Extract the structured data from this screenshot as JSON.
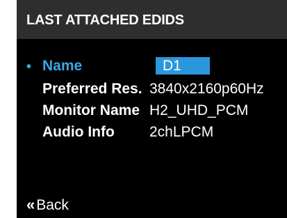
{
  "header": {
    "title": "LAST ATTACHED EDIDS"
  },
  "colors": {
    "selected_text": "#3ca7e0",
    "selected_box": "#2b97dd",
    "header_bg": "#2e2e2e",
    "screen_bg": "#000000"
  },
  "rows": [
    {
      "label": "Name",
      "value": "D1",
      "selected": true,
      "bullet": "•"
    },
    {
      "label": "Preferred Res.",
      "value": "3840x2160p60Hz"
    },
    {
      "label": "Monitor Name",
      "value": "H2_UHD_PCM"
    },
    {
      "label": "Audio Info",
      "value": "2chLPCM"
    }
  ],
  "footer": {
    "back_icon": "«",
    "back_label": "Back"
  }
}
